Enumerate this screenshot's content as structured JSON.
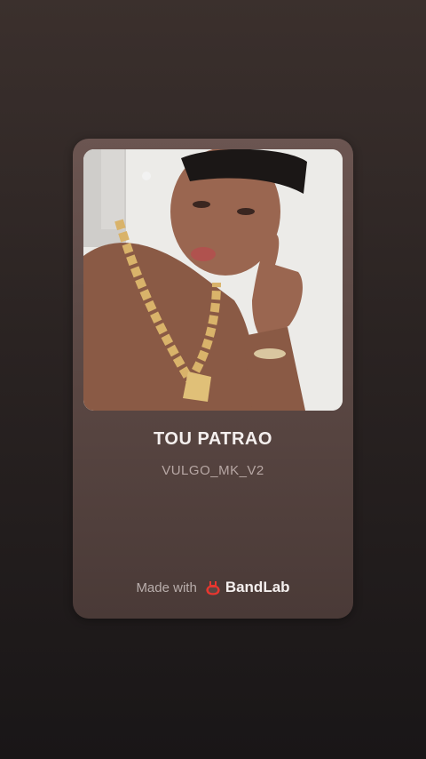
{
  "track": {
    "title": "TOU PATRAO",
    "artist": "VULGO_MK_V2"
  },
  "footer": {
    "made_with": "Made with",
    "brand": "BandLab"
  },
  "icons": {
    "brand_logo": "bandlab-logo-icon",
    "artwork": "cover-artwork-photo"
  },
  "colors": {
    "brand_red": "#e8362f",
    "card_bg": "#5a4743",
    "page_bg": "#2a2322"
  }
}
